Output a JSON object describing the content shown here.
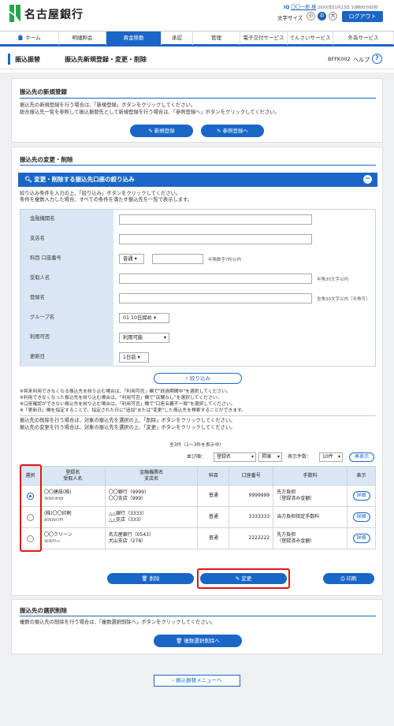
{
  "header": {
    "bank_name": "名古屋銀行",
    "user_prefix": "IQ",
    "user_name": "〇〇一郎 様",
    "login_time": "20XX年01月23日 10時00分00秒",
    "font_size_label": "文字サイズ",
    "font_sizes": [
      "小",
      "中",
      "大"
    ],
    "logout_label": "ログアウト"
  },
  "nav": {
    "items": [
      "ホーム",
      "明細照会",
      "資金移動",
      "承認",
      "管理",
      "電子交付サービス",
      "でんさいサービス",
      "外為サービス"
    ],
    "active_index": 2
  },
  "page": {
    "title1": "振込振替",
    "title2": "振込先新規登録・変更・削除",
    "screen_code": "BFFK002",
    "help_label": "ヘルプ",
    "help_icon": "?"
  },
  "new_reg": {
    "title": "振込先の新規登録",
    "desc1": "振込先の新規登録を行う場合は、「新規登録」ボタンをクリックしてください。",
    "desc2": "総合振込先一覧を参照して振込振替先として新規登録を行う場合は、「参照登録へ」ボタンをクリックしてください。",
    "btn_new": "新規登録",
    "btn_ref": "参照登録へ"
  },
  "change": {
    "title": "振込先の変更・削除",
    "filter_bar": "変更・削除する振込先口座の絞り込み",
    "filter_desc1": "絞り込み条件を入力の上、「絞り込み」ボタンをクリックしてください。",
    "filter_desc2": "条件を複数入力した場合、すべての条件を満たす振込先を一覧で表示します。",
    "fields": {
      "bank": "金融機関名",
      "branch": "支店名",
      "account": "科目 口座番号",
      "account_type": "普通",
      "account_hint": "半角数字7桁以内",
      "payee": "受取人名",
      "payee_hint": "半角30文字以内",
      "reg_name": "登録名",
      "reg_hint": "全角30文字以内［半角可］",
      "group": "グループ名",
      "group_value": "01 10日締め",
      "usable": "利用可否",
      "usable_value": "利用可能",
      "updated": "更新日",
      "updated_value": "1日前"
    },
    "btn_filter": "絞り込み",
    "notes": [
      "※将来利用できなくなる振込先を絞り込む場合は、「利用可否」欄で\"経過期間中\"を選択してください。",
      "※利用できなくなった振込先を絞り込む場合は、「利用可否」欄で\"店舗なし\"を選択してください。",
      "※口座確認ができない振込先を絞り込む場合は、「利用可否」欄で\"口座名義不一致\"を選択してください。",
      "※「更新日」欄を指定することで、指定された日に\"追加\"または\"変更\"した振込先を検索することができます。"
    ],
    "list_desc1": "振込先の削除を行う場合は、対象の振込先を選択の上、「削除」ボタンをクリックしてください。",
    "list_desc2": "振込先の変更を行う場合は、対象の振込先を選択の上、「変更」ボタンをクリックしてください。",
    "count_text": "全3件（1～3件を表示中）",
    "sort_label": "並び順：",
    "sort_value": "登録名",
    "order_value": "昇順",
    "per_page_label": "表示件数：",
    "per_page_value": "10件",
    "redisplay": "再表示",
    "table": {
      "headers": [
        "選択",
        "登録名\n受取人名",
        "金融機関名\n支店名",
        "科目",
        "口座番号",
        "手数料",
        "表示"
      ],
      "rows": [
        {
          "reg": "〇〇建設(株)",
          "payee": "ﾏﾙﾏﾙｹﾝｾﾂ(ｶ",
          "bank": "〇〇銀行（9999）",
          "branch": "〇〇支店（999）",
          "type": "普通",
          "acct": "9999999",
          "fee1": "先方負担",
          "fee2": "（登録済み金額）",
          "detail": "詳細",
          "selected": true
        },
        {
          "reg": "(株)〇〇印刷",
          "payee": "ｶ)ﾏﾙﾏﾙｲﾝｻﾂ",
          "bank": "△△銀行（3333）",
          "branch": "△△支店（333）",
          "type": "普通",
          "acct": "3333333",
          "fee1": "当方負担指定手数料",
          "fee2": "",
          "detail": "詳細",
          "selected": false
        },
        {
          "reg": "〇〇クリーン",
          "payee": "ﾏﾙﾏﾙｸﾘｰﾝ",
          "bank": "名古屋銀行（0543）",
          "branch": "犬山支店（278）",
          "type": "普通",
          "acct": "2222222",
          "fee1": "先方負担",
          "fee2": "（登録済み金額）",
          "detail": "詳細",
          "selected": false
        }
      ]
    },
    "btn_delete": "削除",
    "btn_change": "変更",
    "btn_print": "印刷"
  },
  "bulk": {
    "title": "振込先の選択削除",
    "desc": "複数の振込先の削除を行う場合は、「複数選択削除へ」ボタンをクリックしてください。",
    "btn": "複数選択削除へ"
  },
  "back_btn": "振込振替メニューへ",
  "colors": {
    "accent": "#1a66c7",
    "highlight": "#e0161b",
    "label_bg": "#dbe6f4"
  }
}
